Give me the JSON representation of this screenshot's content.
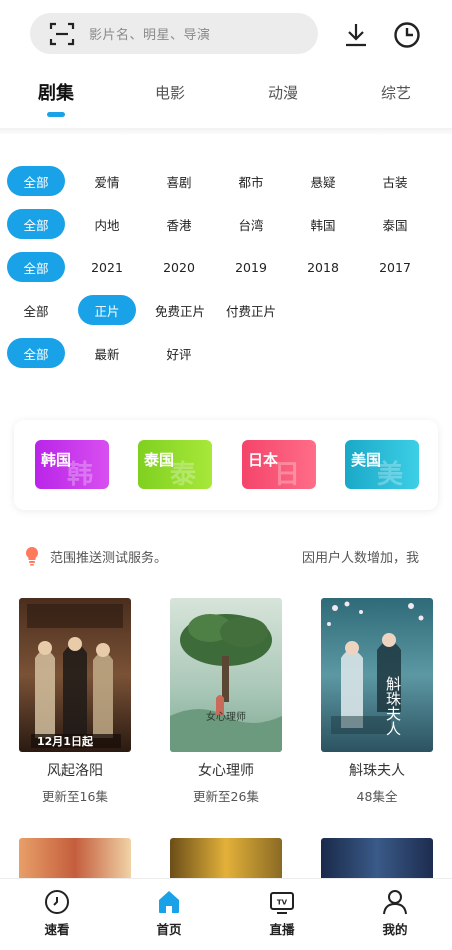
{
  "search": {
    "placeholder": "影片名、明星、导演"
  },
  "tabs": [
    {
      "label": "剧集",
      "active": true
    },
    {
      "label": "电影",
      "active": false
    },
    {
      "label": "动漫",
      "active": false
    },
    {
      "label": "综艺",
      "active": false
    }
  ],
  "filters": {
    "genre": {
      "selected": "全部",
      "options": [
        "全部",
        "爱情",
        "喜剧",
        "都市",
        "悬疑",
        "古装"
      ]
    },
    "region": {
      "selected": "全部",
      "options": [
        "全部",
        "内地",
        "香港",
        "台湾",
        "韩国",
        "泰国"
      ]
    },
    "year": {
      "selected": "全部",
      "options": [
        "全部",
        "2021",
        "2020",
        "2019",
        "2018",
        "2017"
      ]
    },
    "pay": {
      "selected": "正片",
      "options": [
        "全部",
        "正片",
        "免费正片",
        "付费正片"
      ]
    },
    "sort": {
      "selected": "全部",
      "options": [
        "全部",
        "最新",
        "好评"
      ]
    }
  },
  "regions": [
    {
      "label": "韩国",
      "ghost": "韩",
      "color_from": "#b925e8",
      "color_to": "#d84ff0"
    },
    {
      "label": "泰国",
      "ghost": "泰",
      "color_from": "#7fd01f",
      "color_to": "#a8e83a"
    },
    {
      "label": "日本",
      "ghost": "日",
      "color_from": "#f4446a",
      "color_to": "#ff6d88"
    },
    {
      "label": "美国",
      "ghost": "美",
      "color_from": "#1aa8c8",
      "color_to": "#3dcfe6"
    }
  ],
  "notice": {
    "text_left": "范围推送测试服务。",
    "text_right": "因用户人数增加，我"
  },
  "posters": [
    {
      "title": "风起洛阳",
      "status": "更新至16集",
      "poster_caption": "12月1日起"
    },
    {
      "title": "女心理师",
      "status": "更新至26集",
      "poster_caption": "女心理师"
    },
    {
      "title": "斛珠夫人",
      "status": "48集全",
      "poster_caption": "斛珠夫人"
    }
  ],
  "bottom_nav": [
    {
      "label": "速看",
      "icon": "clock-icon"
    },
    {
      "label": "首页",
      "icon": "home-icon",
      "active": true
    },
    {
      "label": "直播",
      "icon": "tv-icon"
    },
    {
      "label": "我的",
      "icon": "user-icon"
    }
  ],
  "colors": {
    "accent": "#1aa2e8"
  }
}
